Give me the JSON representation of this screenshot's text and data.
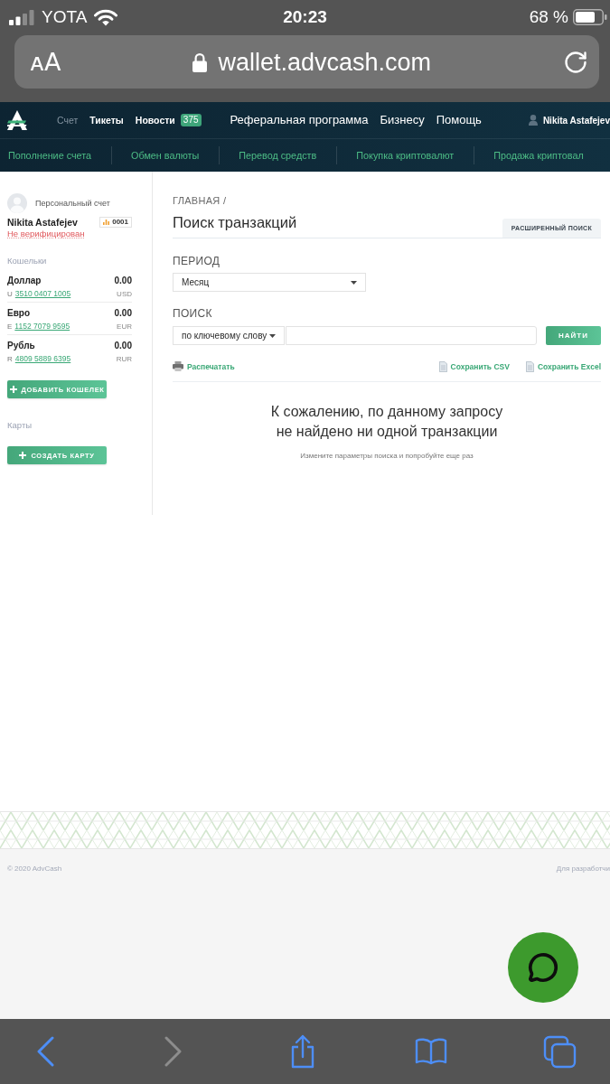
{
  "status_bar": {
    "carrier": "YOTA",
    "time": "20:23",
    "battery": "68 %"
  },
  "address_bar": {
    "text_size": "ᴀA",
    "url": "wallet.advcash.com"
  },
  "top_nav": {
    "links": [
      {
        "label": "Счет",
        "selected": true
      },
      {
        "label": "Тикеты",
        "selected": false
      },
      {
        "label": "Новости",
        "selected": false,
        "badge": "375"
      }
    ],
    "main_links": [
      "Реферальная программа",
      "Бизнесу",
      "Помощь"
    ],
    "user": "Nikita Astafejev"
  },
  "sub_nav": [
    "Пополнение счета",
    "Обмен валюты",
    "Перевод средств",
    "Покупка криптовалют",
    "Продажа криптовал"
  ],
  "sidebar": {
    "account_type": "Персональный счет",
    "name": "Nikita Astafejev",
    "account_number": "0001",
    "status": "Не верифицирован",
    "wallets_title": "Кошельки",
    "wallets": [
      {
        "name": "Доллар",
        "amount": "0.00",
        "prefix": "U",
        "number": "3510 0407 1005",
        "currency": "USD"
      },
      {
        "name": "Евро",
        "amount": "0.00",
        "prefix": "E",
        "number": "1152 7079 9595",
        "currency": "EUR"
      },
      {
        "name": "Рубль",
        "amount": "0.00",
        "prefix": "R",
        "number": "4809 5889 6395",
        "currency": "RUR"
      }
    ],
    "add_wallet_button": "ДОБАВИТЬ КОШЕЛЕК",
    "cards_title": "Карты",
    "create_card_button": "СОЗДАТЬ КАРТУ"
  },
  "main": {
    "breadcrumb": "ГЛАВНАЯ /",
    "title": "Поиск транзакций",
    "advanced_search_button": "РАСШИРЕННЫЙ ПОИСК",
    "period": {
      "label": "ПЕРИОД",
      "value": "Месяц"
    },
    "search": {
      "label": "ПОИСК",
      "mode": "по ключевому слову",
      "button": "НАЙТИ"
    },
    "actions": [
      {
        "kind": "print",
        "label": "Распечатать"
      },
      {
        "kind": "export",
        "label": "Сохранить CSV"
      },
      {
        "kind": "export",
        "label": "Сохранить Excel"
      }
    ],
    "empty_state": {
      "title": "К сожалению, по данному запросу\nне найдено ни одной транзакции",
      "hint": "Измените параметры поиска и попробуйте еще раз"
    }
  },
  "footer": {
    "copyright": "© 2020 AdvCash",
    "developers_link": "Для разработчи"
  },
  "browser_toolbar": [
    {
      "kind": "back",
      "disabled": false
    },
    {
      "kind": "forward",
      "disabled": true
    },
    {
      "kind": "share",
      "disabled": false
    },
    {
      "kind": "bookmarks",
      "disabled": false
    },
    {
      "kind": "tabs",
      "disabled": false
    }
  ]
}
